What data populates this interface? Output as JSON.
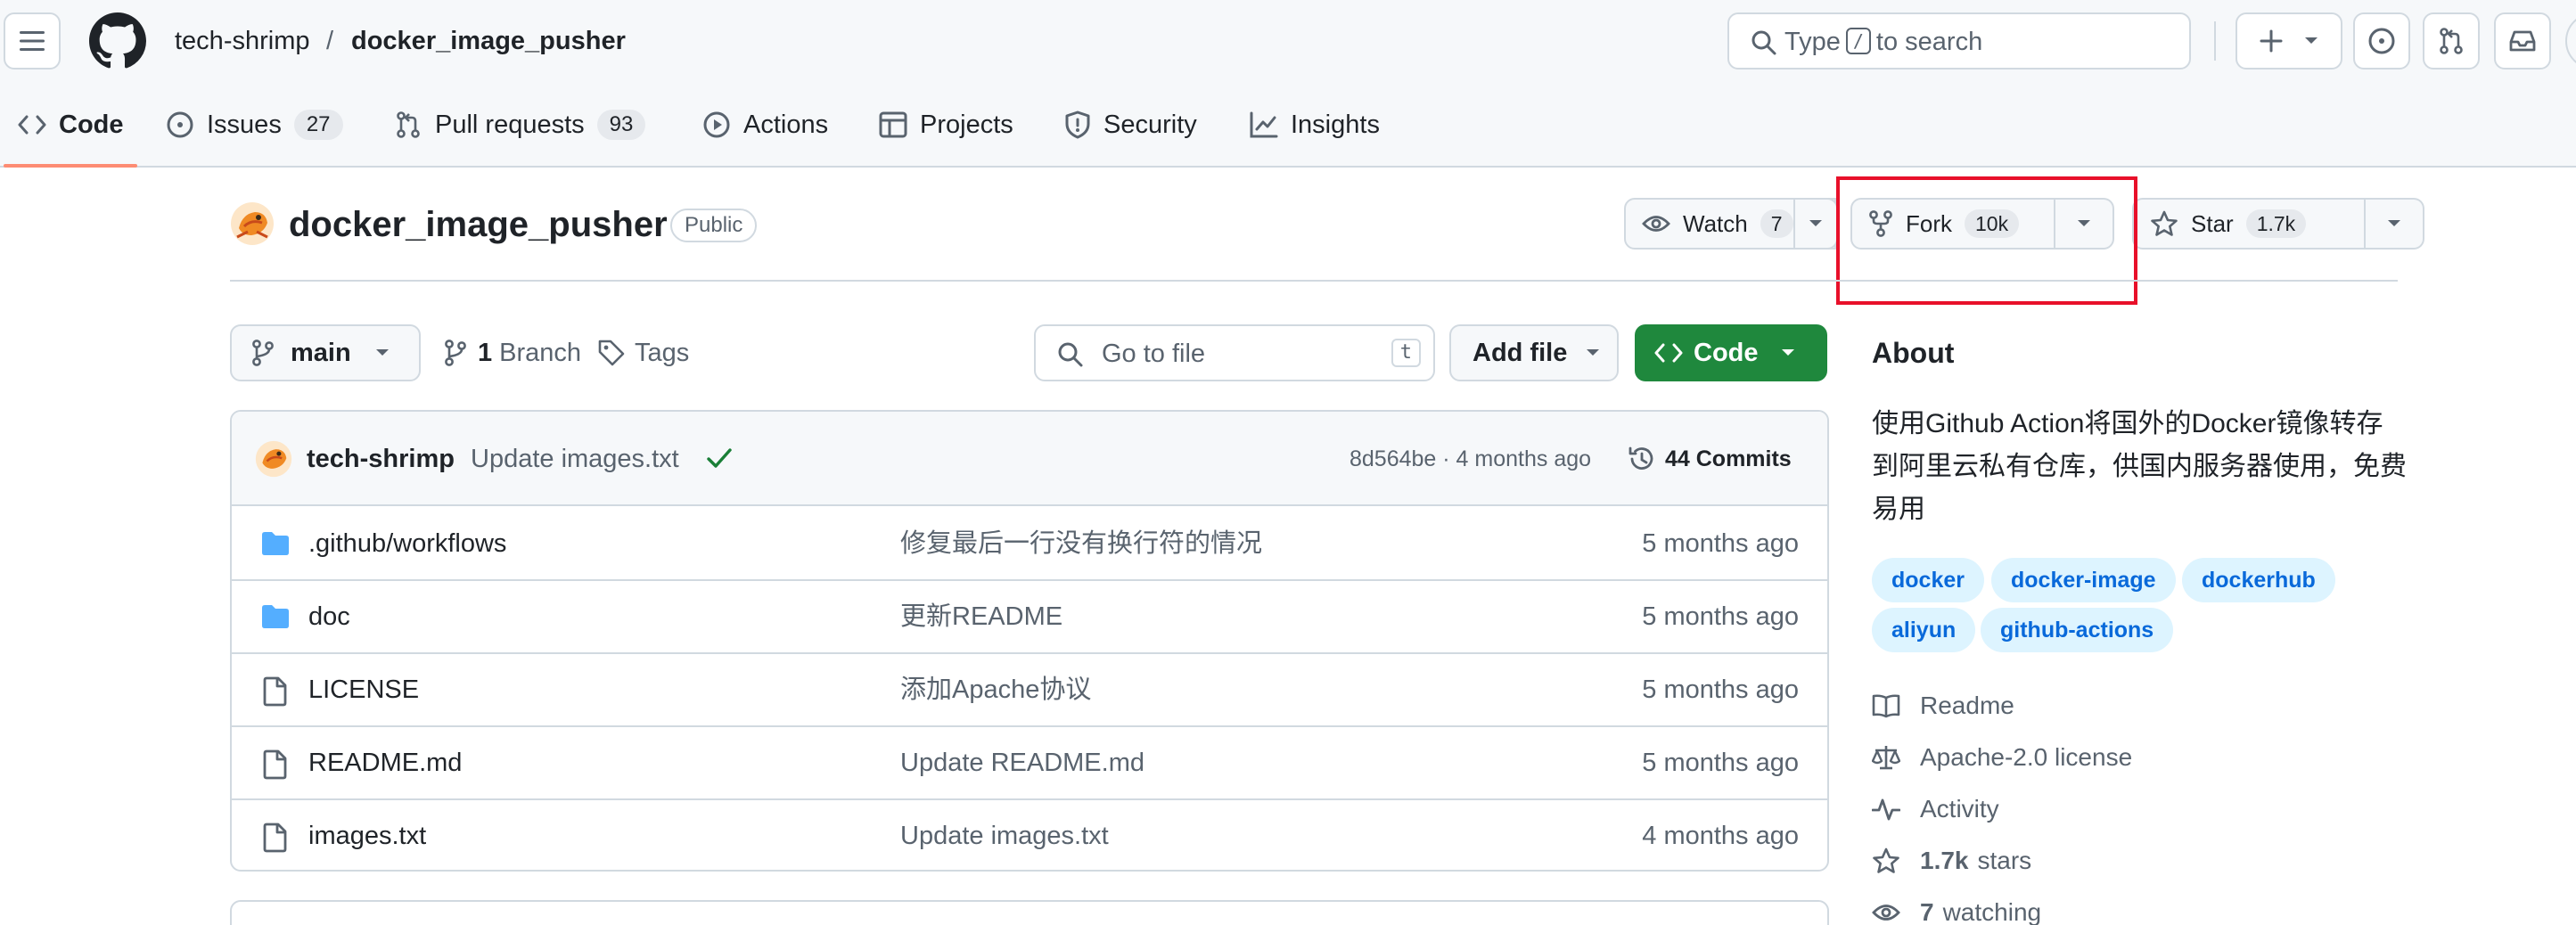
{
  "header": {
    "owner": "tech-shrimp",
    "separator": "/",
    "repo": "docker_image_pusher",
    "search_prefix": "Type",
    "search_key": "/",
    "search_suffix": "to search"
  },
  "nav": {
    "tabs": [
      {
        "label": "Code"
      },
      {
        "label": "Issues",
        "count": "27"
      },
      {
        "label": "Pull requests",
        "count": "93"
      },
      {
        "label": "Actions"
      },
      {
        "label": "Projects"
      },
      {
        "label": "Security"
      },
      {
        "label": "Insights"
      }
    ]
  },
  "repo": {
    "name": "docker_image_pusher",
    "visibility": "Public",
    "watch_label": "Watch",
    "watch_count": "7",
    "fork_label": "Fork",
    "fork_count": "10k",
    "star_label": "Star",
    "star_count": "1.7k"
  },
  "browser": {
    "branch": "main",
    "branch_count": "1",
    "branch_label": "Branch",
    "tags_label": "Tags",
    "goto_placeholder": "Go to file",
    "goto_key": "t",
    "add_file_label": "Add file",
    "code_label": "Code"
  },
  "commit": {
    "author": "tech-shrimp",
    "message": "Update images.txt",
    "meta": "8d564be · 4 months ago",
    "commits_label": "44 Commits"
  },
  "files": [
    {
      "type": "folder",
      "name": ".github/workflows",
      "message": "修复最后一行没有换行符的情况",
      "date": "5 months ago"
    },
    {
      "type": "folder",
      "name": "doc",
      "message": "更新README",
      "date": "5 months ago"
    },
    {
      "type": "file",
      "name": "LICENSE",
      "message": "添加Apache协议",
      "date": "5 months ago"
    },
    {
      "type": "file",
      "name": "README.md",
      "message": "Update README.md",
      "date": "5 months ago"
    },
    {
      "type": "file",
      "name": "images.txt",
      "message": "Update images.txt",
      "date": "4 months ago"
    }
  ],
  "about": {
    "title": "About",
    "description": "使用Github Action将国外的Docker镜像转存到阿里云私有仓库，供国内服务器使用，免费易用",
    "topics": [
      "docker",
      "docker-image",
      "dockerhub",
      "aliyun",
      "github-actions"
    ],
    "readme": "Readme",
    "license": "Apache-2.0 license",
    "activity": "Activity",
    "stars_count": "1.7k",
    "stars_label": "stars",
    "watching_count": "7",
    "watching_label": "watching"
  },
  "colors": {
    "accent_green": "#1f883d",
    "link_blue": "#0969da",
    "highlight_red": "#e8102a",
    "tab_underline": "#fd8c73",
    "folder_blue": "#54aeff"
  }
}
